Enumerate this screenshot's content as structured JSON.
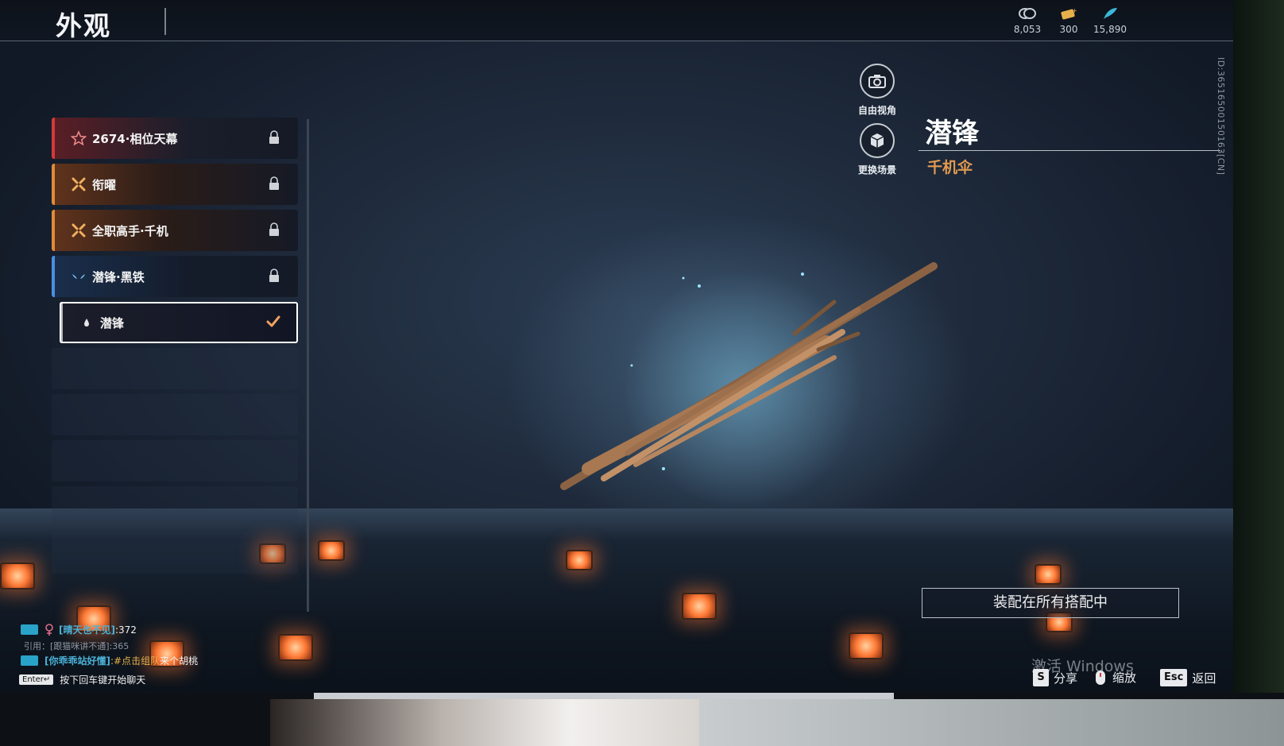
{
  "header": {
    "title": "外观",
    "currencies": [
      {
        "icon": "coin-stack-icon",
        "value": "8,053"
      },
      {
        "icon": "ticket-icon",
        "value": "300"
      },
      {
        "icon": "feather-icon",
        "value": "15,890"
      }
    ]
  },
  "skins": [
    {
      "name": "2674·相位天幕",
      "rarity": "red",
      "icon": "star-icon",
      "state": "locked"
    },
    {
      "name": "衔曜",
      "rarity": "orange",
      "icon": "burst-icon",
      "state": "locked"
    },
    {
      "name": "全职高手·千机",
      "rarity": "orange",
      "icon": "burst-icon",
      "state": "locked"
    },
    {
      "name": "潜锋·黑铁",
      "rarity": "blue",
      "icon": "wings-icon",
      "state": "locked"
    },
    {
      "name": "潜锋",
      "rarity": "white",
      "icon": "drop-icon",
      "state": "selected"
    }
  ],
  "view_controls": {
    "free_view_label": "自由视角",
    "change_scene_label": "更换场景"
  },
  "item": {
    "name": "潜锋",
    "type": "千机伞"
  },
  "player_id": "ID:365165001501​63[CN]",
  "equip_all_label": "装配在所有搭配中",
  "watermark": "激活 Windows",
  "hints": {
    "share_key": "S",
    "share_label": "分享",
    "zoom_label": "缩放",
    "back_key": "Esc",
    "back_label": "返回"
  },
  "chat": {
    "line1_name": "[晴天也不见]",
    "line1_msg": ":372",
    "line2_quote": "引用：[跟猫咪讲不通]:365",
    "line3_name": "[你乖乖站好懂]",
    "line3_link": ":#点击组队",
    "line3_msg": "来个胡桃",
    "enter_key": "Enter↵",
    "enter_hint": "按下回车键开始聊天"
  },
  "colors": {
    "accent_orange": "#e09a50",
    "rarity_red": "#d33a3a",
    "rarity_orange": "#e08a3a",
    "rarity_blue": "#4a8fe0",
    "chat_name": "#4ab2d8"
  }
}
